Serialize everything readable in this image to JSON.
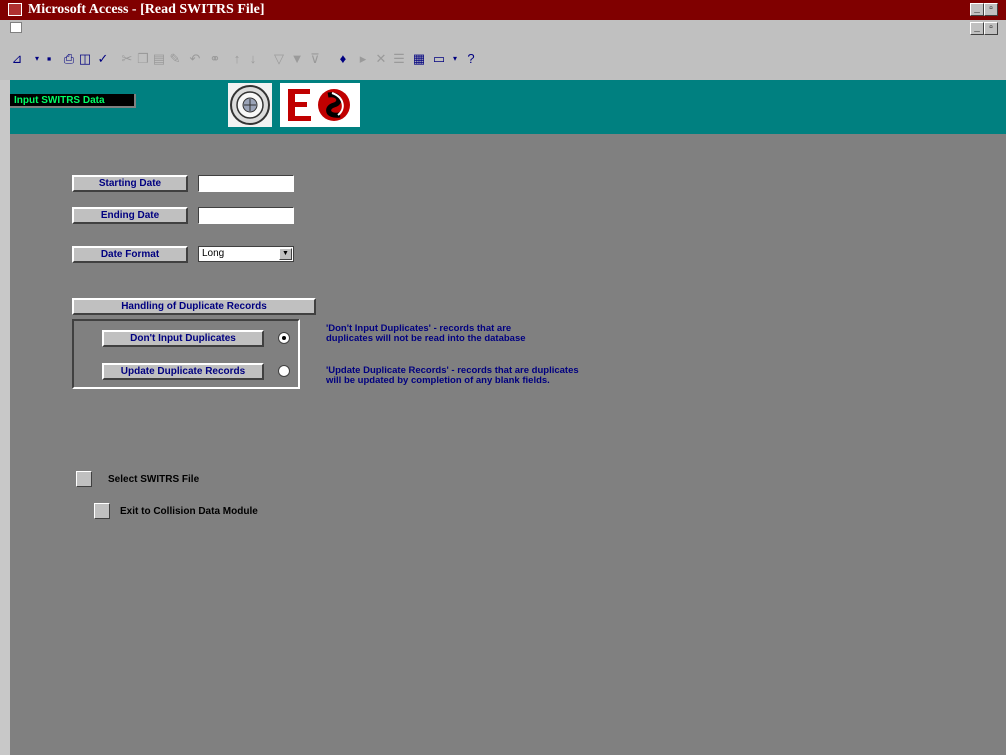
{
  "window": {
    "title": "Microsoft Access - [Read SWITRS File]",
    "buttons": [
      "_",
      "▫",
      "×"
    ]
  },
  "toolbar": {
    "icons": [
      "view-icon",
      "save-icon",
      "print-icon",
      "print-preview-icon",
      "spelling-icon",
      "cut-icon",
      "copy-icon",
      "paste-icon",
      "format-painter-icon",
      "undo-icon",
      "insert-hyperlink-icon",
      "sort-ascending-icon",
      "sort-descending-icon",
      "filter-by-selection-icon",
      "filter-by-form-icon",
      "apply-filter-icon",
      "find-icon",
      "new-record-icon",
      "delete-record-icon",
      "properties-icon",
      "database-window-icon",
      "new-object-icon",
      "help-icon"
    ]
  },
  "header": {
    "label": "Input SWITRS Data"
  },
  "form": {
    "starting_date": {
      "label": "Starting Date",
      "value": ""
    },
    "ending_date": {
      "label": "Ending Date",
      "value": ""
    },
    "date_format": {
      "label": "Date Format",
      "value": "Long"
    },
    "duplicates": {
      "title": "Handling of Duplicate Records",
      "option1": {
        "label": "Don't Input Duplicates",
        "selected": true
      },
      "option2": {
        "label": "Update Duplicate Records",
        "selected": false
      },
      "note1_line1": "'Don't Input Duplicates' - records that are",
      "note1_line2": "duplicates will not be read into the database",
      "note2_line1": "'Update Duplicate Records' - records that are duplicates",
      "note2_line2": "will be updated by completion of any blank fields."
    },
    "select_file_label": "Select SWITRS File",
    "exit_label": "Exit to Collision Data Module"
  },
  "colors": {
    "titlebar": "#800000",
    "header": "#008080",
    "detail": "#808080",
    "label_text": "#000080",
    "header_label_text": "#00ff66"
  }
}
